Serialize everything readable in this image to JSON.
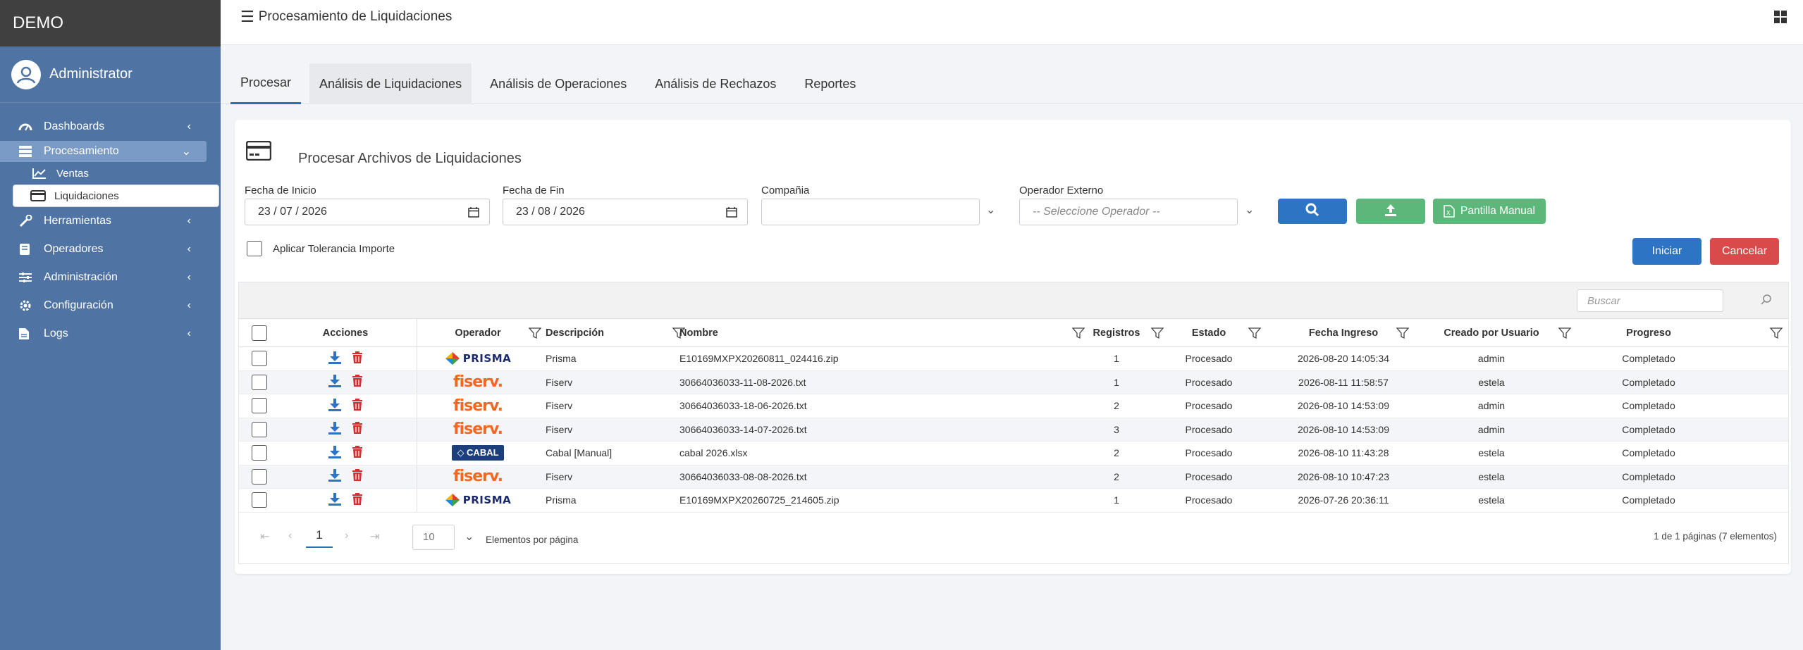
{
  "app": {
    "brand": "DEMO",
    "user_name": "Administrator",
    "page_title": "Procesamiento de Liquidaciones"
  },
  "sidebar": {
    "items": [
      {
        "label": "Dashboards",
        "icon": "dashboard-icon"
      },
      {
        "label": "Procesamiento",
        "icon": "server-icon"
      },
      {
        "label": "Ventas",
        "icon": "chart-line-icon"
      },
      {
        "label": "Liquidaciones",
        "icon": "credit-card-icon"
      },
      {
        "label": "Herramientas",
        "icon": "wrench-icon"
      },
      {
        "label": "Operadores",
        "icon": "book-icon"
      },
      {
        "label": "Administración",
        "icon": "sliders-icon"
      },
      {
        "label": "Configuración",
        "icon": "gear-icon"
      },
      {
        "label": "Logs",
        "icon": "file-icon"
      }
    ]
  },
  "tabs": [
    "Procesar",
    "Análisis de Liquidaciones",
    "Análisis de Operaciones",
    "Análisis de Rechazos",
    "Reportes"
  ],
  "panel": {
    "title": "Procesar Archivos de Liquidaciones",
    "fecha_inicio_label": "Fecha de Inicio",
    "fecha_inicio_value": "23 / 07 / 2026",
    "fecha_fin_label": "Fecha de Fin",
    "fecha_fin_value": "23 / 08 / 2026",
    "compania_label": "Compañia",
    "compania_value": "",
    "operador_label": "Operador Externo",
    "operador_placeholder": "-- Seleccione Operador --",
    "manual_button": "Pantilla Manual",
    "tolerancia_label": "Aplicar Tolerancia Importe",
    "iniciar_button": "Iniciar",
    "cancelar_button": "Cancelar"
  },
  "grid": {
    "search_placeholder": "Buscar",
    "columns": [
      "Acciones",
      "Operador",
      "Descripción",
      "Nombre",
      "Registros",
      "Estado",
      "Fecha Ingreso",
      "Creado por Usuario",
      "Progreso"
    ],
    "rows": [
      {
        "operador": "prisma",
        "descripcion": "Prisma",
        "nombre": "E10169MXPX20260811_024416.zip",
        "registros": "1",
        "estado": "Procesado",
        "fecha": "2026-08-20 14:05:34",
        "usuario": "admin",
        "progreso": "Completado"
      },
      {
        "operador": "fiserv",
        "descripcion": "Fiserv",
        "nombre": "30664036033-11-08-2026.txt",
        "registros": "1",
        "estado": "Procesado",
        "fecha": "2026-08-11 11:58:57",
        "usuario": "estela",
        "progreso": "Completado"
      },
      {
        "operador": "fiserv",
        "descripcion": "Fiserv",
        "nombre": "30664036033-18-06-2026.txt",
        "registros": "2",
        "estado": "Procesado",
        "fecha": "2026-08-10 14:53:09",
        "usuario": "admin",
        "progreso": "Completado"
      },
      {
        "operador": "fiserv",
        "descripcion": "Fiserv",
        "nombre": "30664036033-14-07-2026.txt",
        "registros": "3",
        "estado": "Procesado",
        "fecha": "2026-08-10 14:53:09",
        "usuario": "admin",
        "progreso": "Completado"
      },
      {
        "operador": "cabal",
        "descripcion": "Cabal [Manual]",
        "nombre": "cabal 2026.xlsx",
        "registros": "2",
        "estado": "Procesado",
        "fecha": "2026-08-10 11:43:28",
        "usuario": "estela",
        "progreso": "Completado"
      },
      {
        "operador": "fiserv",
        "descripcion": "Fiserv",
        "nombre": "30664036033-08-08-2026.txt",
        "registros": "2",
        "estado": "Procesado",
        "fecha": "2026-08-10 10:47:23",
        "usuario": "estela",
        "progreso": "Completado"
      },
      {
        "operador": "prisma",
        "descripcion": "Prisma",
        "nombre": "E10169MXPX20260725_214605.zip",
        "registros": "1",
        "estado": "Procesado",
        "fecha": "2026-07-26 20:36:11",
        "usuario": "estela",
        "progreso": "Completado"
      }
    ],
    "logos": {
      "prisma": "PRISMA",
      "fiserv": "fiserv.",
      "cabal": "CABAL"
    },
    "pager": {
      "current_page": "1",
      "page_size": "10",
      "page_size_label": "Elementos por página",
      "info": "1 de 1 páginas (7 elementos)"
    }
  },
  "colors": {
    "sidebar": "#4f74a3",
    "primary": "#2d74c4",
    "success": "#5cb87a",
    "danger": "#d94b4b"
  }
}
